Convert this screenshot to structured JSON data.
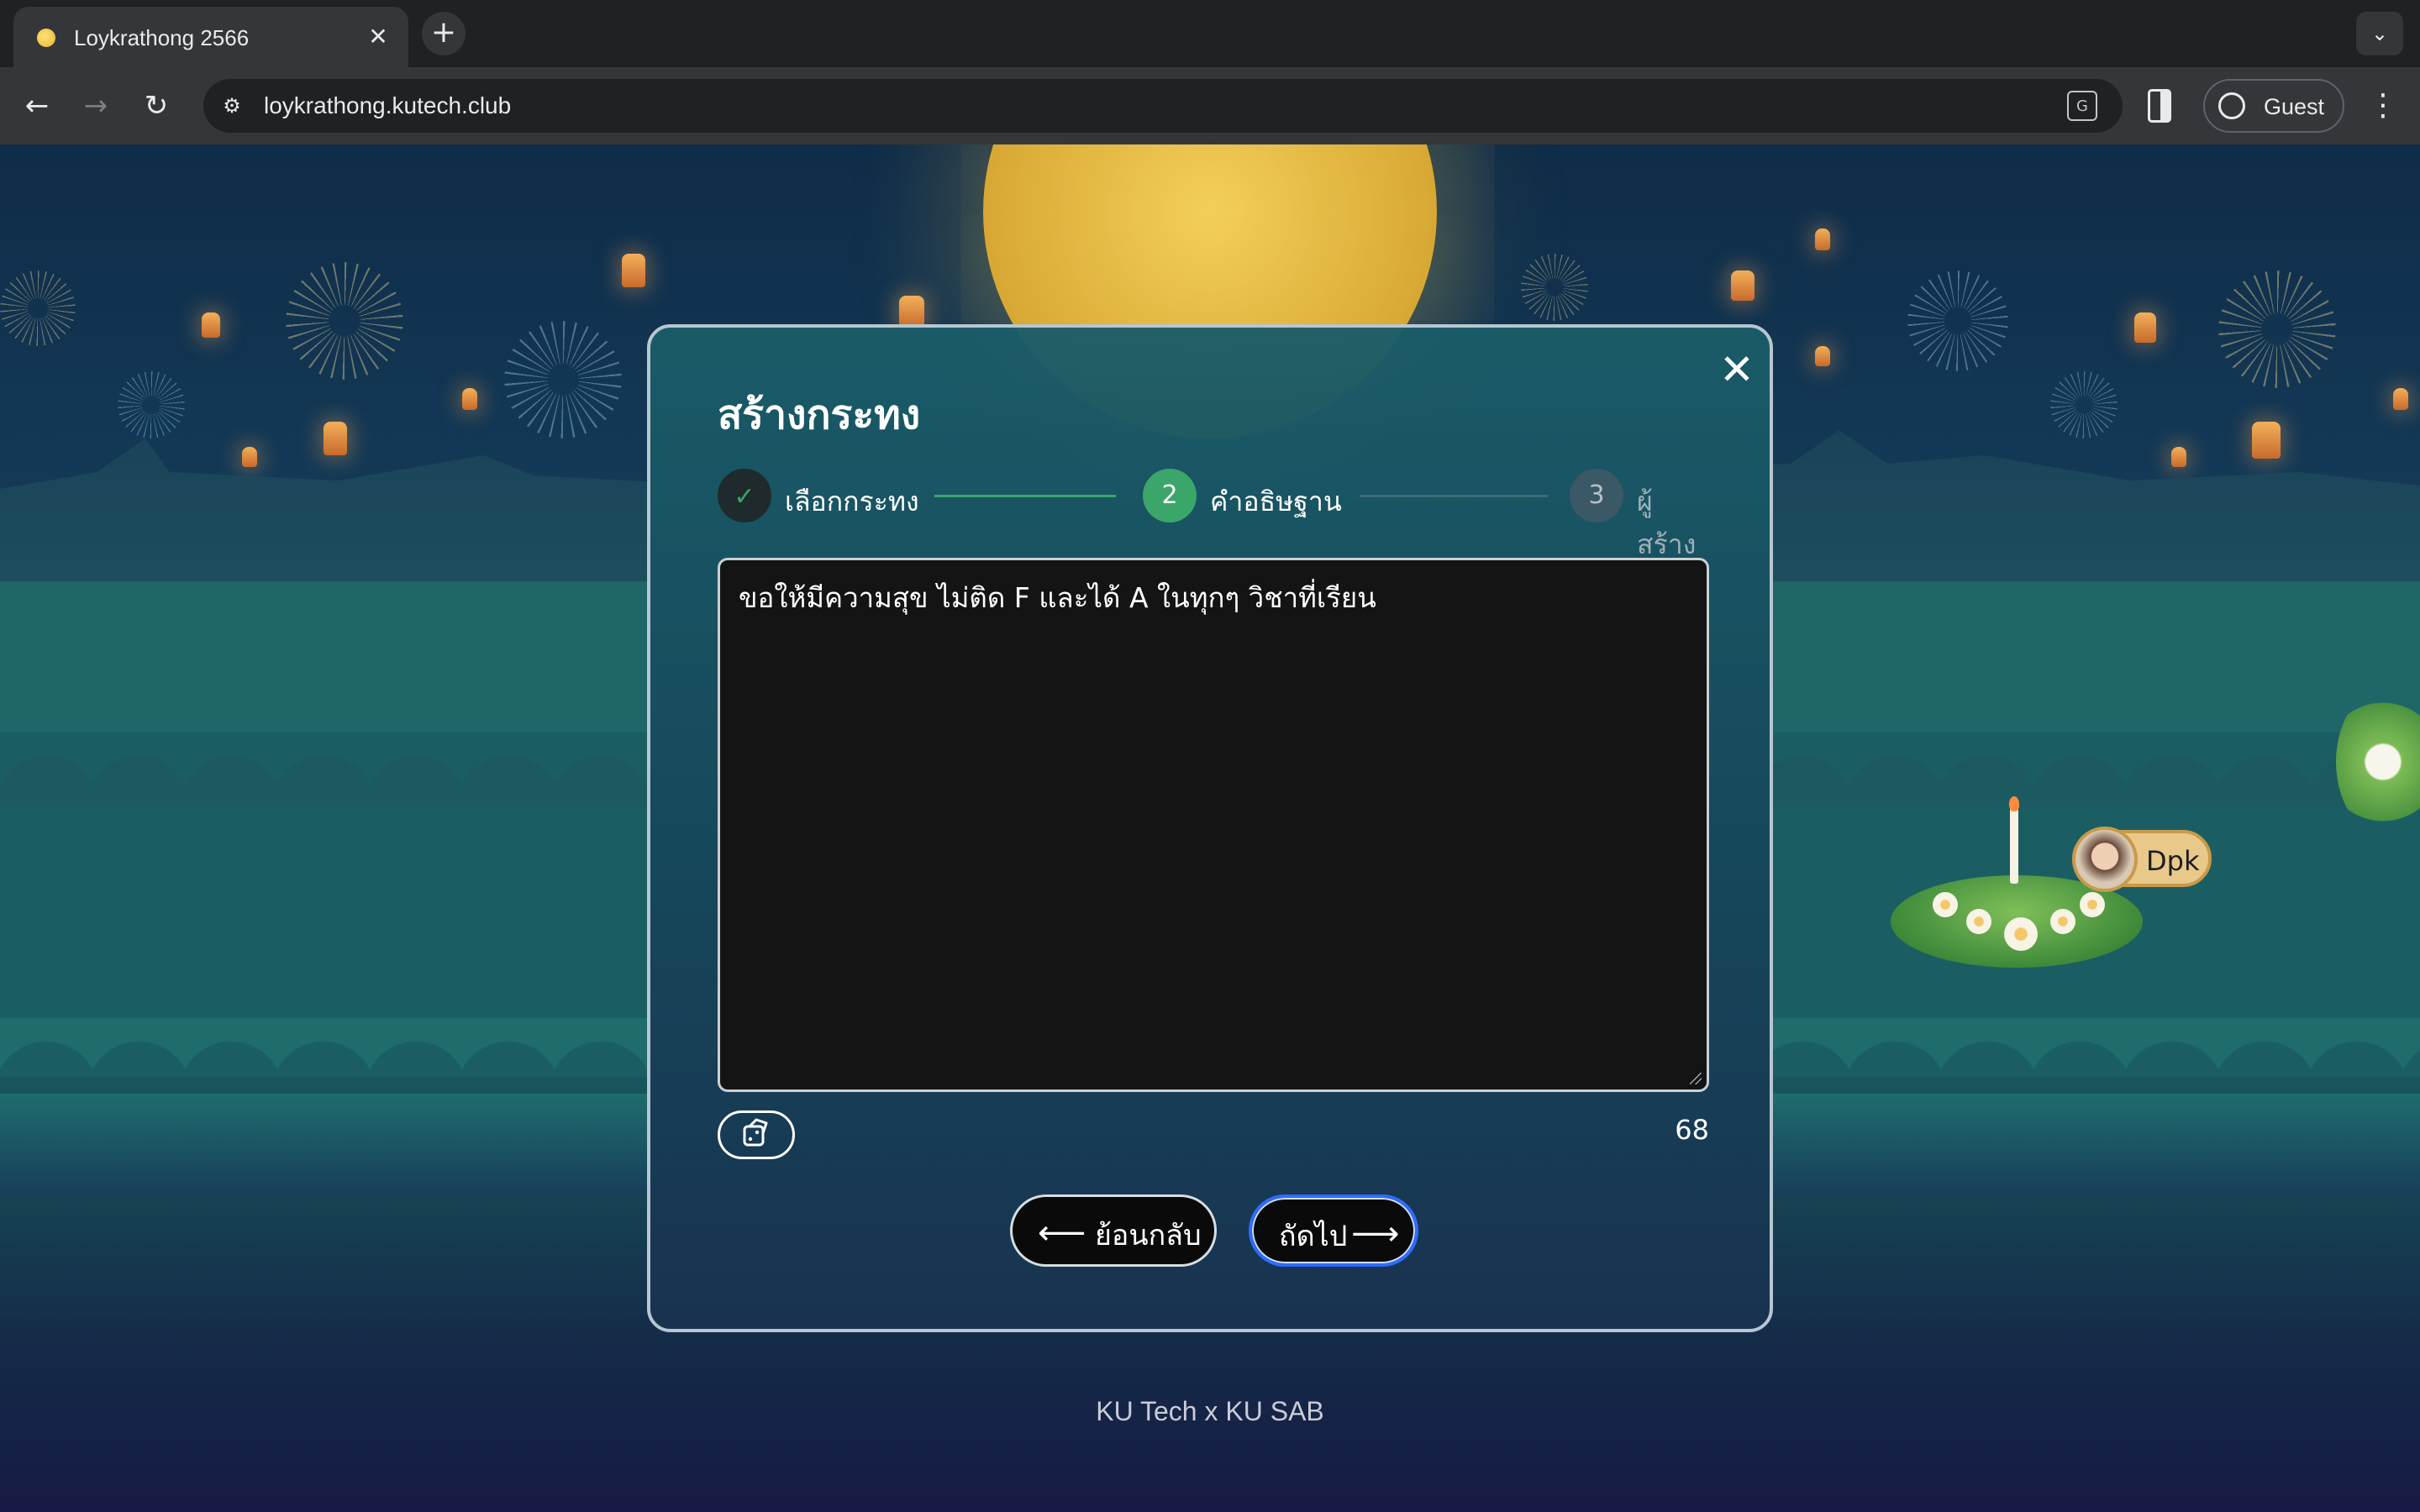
{
  "browser": {
    "tab_title": "Loykrathong 2566",
    "url": "loykrathong.kutech.club",
    "profile_label": "Guest"
  },
  "modal": {
    "title": "สร้างกระทง",
    "steps": [
      {
        "number": "✓",
        "label": "เลือกกระทง",
        "state": "done"
      },
      {
        "number": "2",
        "label": "คำอธิษฐาน",
        "state": "active"
      },
      {
        "number": "3",
        "label": "ผู้สร้าง",
        "state": "pending"
      }
    ],
    "wish_text": "ขอให้มีความสุข ไม่ติด F และได้ A ในทุกๆ วิชาที่เรียน",
    "char_count": "68",
    "back_label": "ย้อนกลับ",
    "next_label": "ถัดไป"
  },
  "scene": {
    "owner_name": "Dpk"
  },
  "footer": {
    "credit": "KU Tech x KU SAB"
  },
  "colors": {
    "step_done": "#1f2a2c",
    "step_active": "#3aa66a",
    "step_pending": "#3a5866",
    "next_border": "#2f6bff"
  }
}
